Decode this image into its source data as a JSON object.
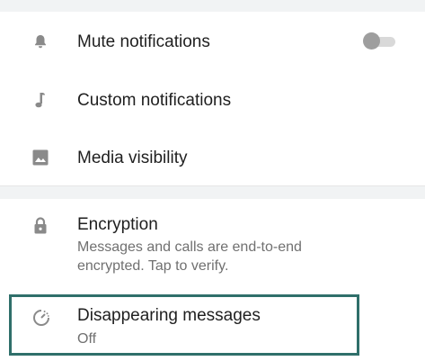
{
  "settings": {
    "mute": {
      "label": "Mute notifications",
      "toggle_on": false
    },
    "custom": {
      "label": "Custom notifications"
    },
    "media": {
      "label": "Media visibility"
    },
    "encryption": {
      "label": "Encryption",
      "desc_line1": "Messages and calls are end-to-end",
      "desc_line2": "encrypted. Tap to verify."
    },
    "disappearing": {
      "label": "Disappearing messages",
      "value": "Off"
    }
  },
  "icons": {
    "mute": "bell-icon",
    "custom": "music-note-icon",
    "media": "image-icon",
    "encryption": "lock-icon",
    "disappearing": "timer-icon"
  },
  "colors": {
    "icon": "#8a8a8a",
    "highlight": "#2f6f6a",
    "toggle_knob": "#9e9e9e",
    "toggle_track": "#d9d9d9"
  }
}
